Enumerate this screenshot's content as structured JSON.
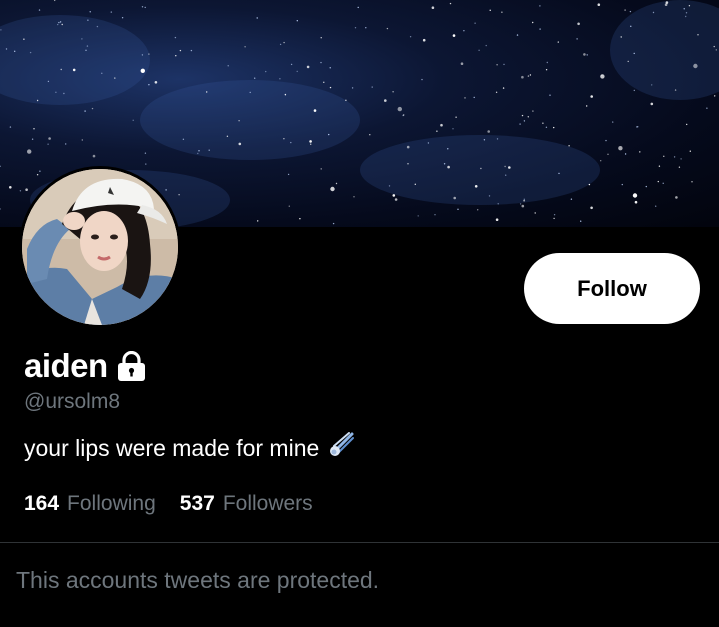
{
  "profile": {
    "display_name": "aiden",
    "handle": "@ursolm8",
    "bio": "your lips were made for mine",
    "following_count": "164",
    "following_label": "Following",
    "followers_count": "537",
    "followers_label": "Followers",
    "protected_notice": "This accounts tweets are protected."
  },
  "actions": {
    "follow_label": "Follow"
  },
  "icons": {
    "lock": "lock-icon",
    "bio_emoji": "comet-icon"
  },
  "colors": {
    "background": "#000000",
    "secondary_text": "#6e767d",
    "follow_button_bg": "#ffffff",
    "follow_button_text": "#000000",
    "divider": "#2f3336"
  }
}
